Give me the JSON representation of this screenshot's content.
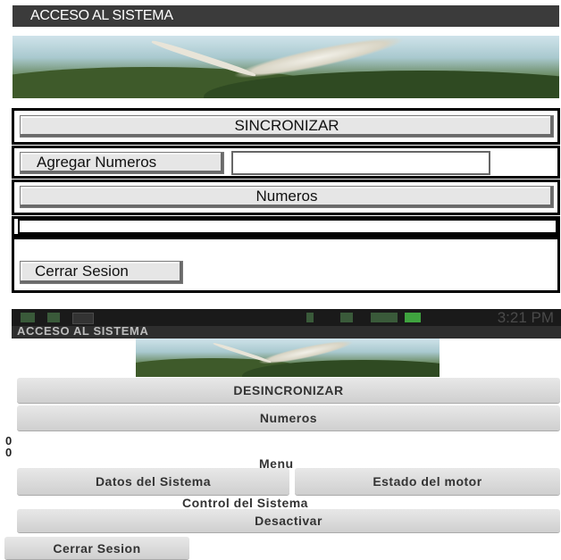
{
  "top_panel": {
    "title": "ACCESO AL SISTEMA",
    "sync_button_label": "SINCRONIZAR",
    "add_numbers_button_label": "Agregar Numeros",
    "add_numbers_input_value": "",
    "numbers_button_label": "Numeros",
    "logout_button_label": "Cerrar Sesion"
  },
  "phone_panel": {
    "status_bar": {
      "time": "3:21 PM"
    },
    "title": "ACCESO AL SISTEMA",
    "unsync_button_label": "DESINCRONIZAR",
    "numbers_button_label": "Numeros",
    "values": [
      "0",
      "0"
    ],
    "menu_label": "Menu",
    "system_data_button_label": "Datos del Sistema",
    "motor_status_button_label": "Estado del motor",
    "control_label": "Control del Sistema",
    "deactivate_button_label": "Desactivar",
    "logout_button_label": "Cerrar Sesion"
  },
  "icons": [
    "banner-image",
    "signal-icon",
    "wifi-icon",
    "battery-icon",
    "notification-icon"
  ],
  "colors": {
    "title_bar": "#3b3b3b",
    "frame_border": "#000000",
    "button_face": "#e6e6e6",
    "phone_button": "#d9d9d9",
    "battery": "#3fa33f"
  }
}
